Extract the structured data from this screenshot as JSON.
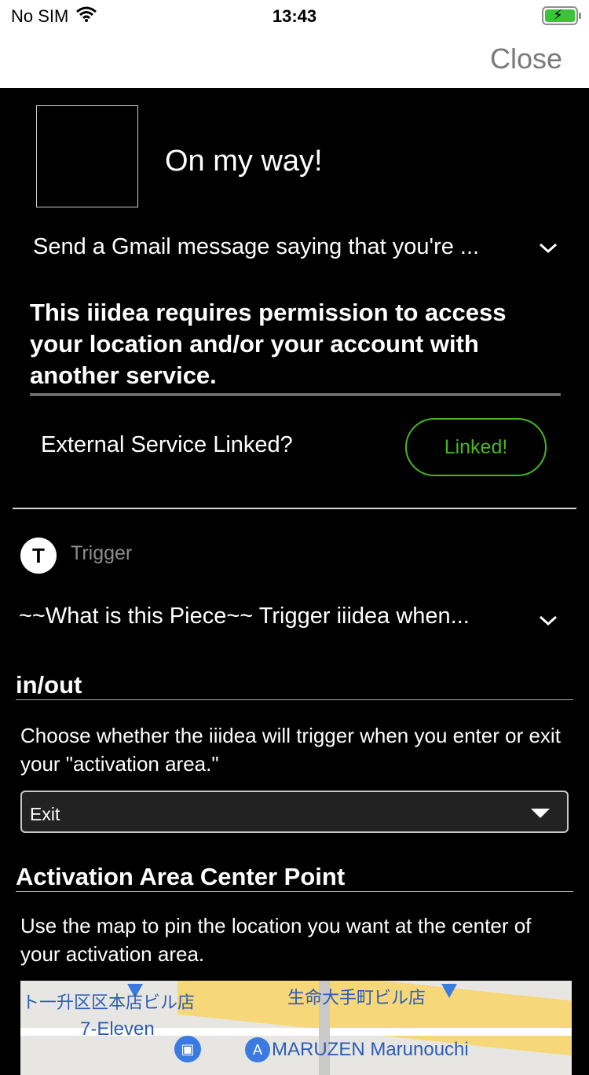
{
  "status_bar": {
    "carrier": "No SIM",
    "time": "13:43"
  },
  "nav": {
    "close_label": "Close"
  },
  "applet": {
    "title": "On my way!",
    "description": "Send a Gmail message saying that you're ...",
    "permission_notice": "This iiidea requires permission to access your location and/or your account with another service.",
    "external_service_label": "External Service Linked?",
    "linked_button_label": "Linked!",
    "linked_color": "#47b81f"
  },
  "trigger": {
    "icon_letter": "T",
    "label": "Trigger",
    "description": "~~What is this Piece~~ Trigger iiidea when..."
  },
  "inout": {
    "title": "in/out",
    "help": "Choose whether the iiidea will trigger when you enter or exit your \"activation area.\"",
    "selected": "Exit"
  },
  "activation_area": {
    "title": "Activation Area Center Point",
    "help": "Use the map to pin the location you want at the center of your activation area."
  },
  "map": {
    "labels": [
      "ト一升区区本店ビル店",
      "生命大手町ビル店",
      "7-Eleven",
      "MARUZEN Marunouchi"
    ]
  }
}
